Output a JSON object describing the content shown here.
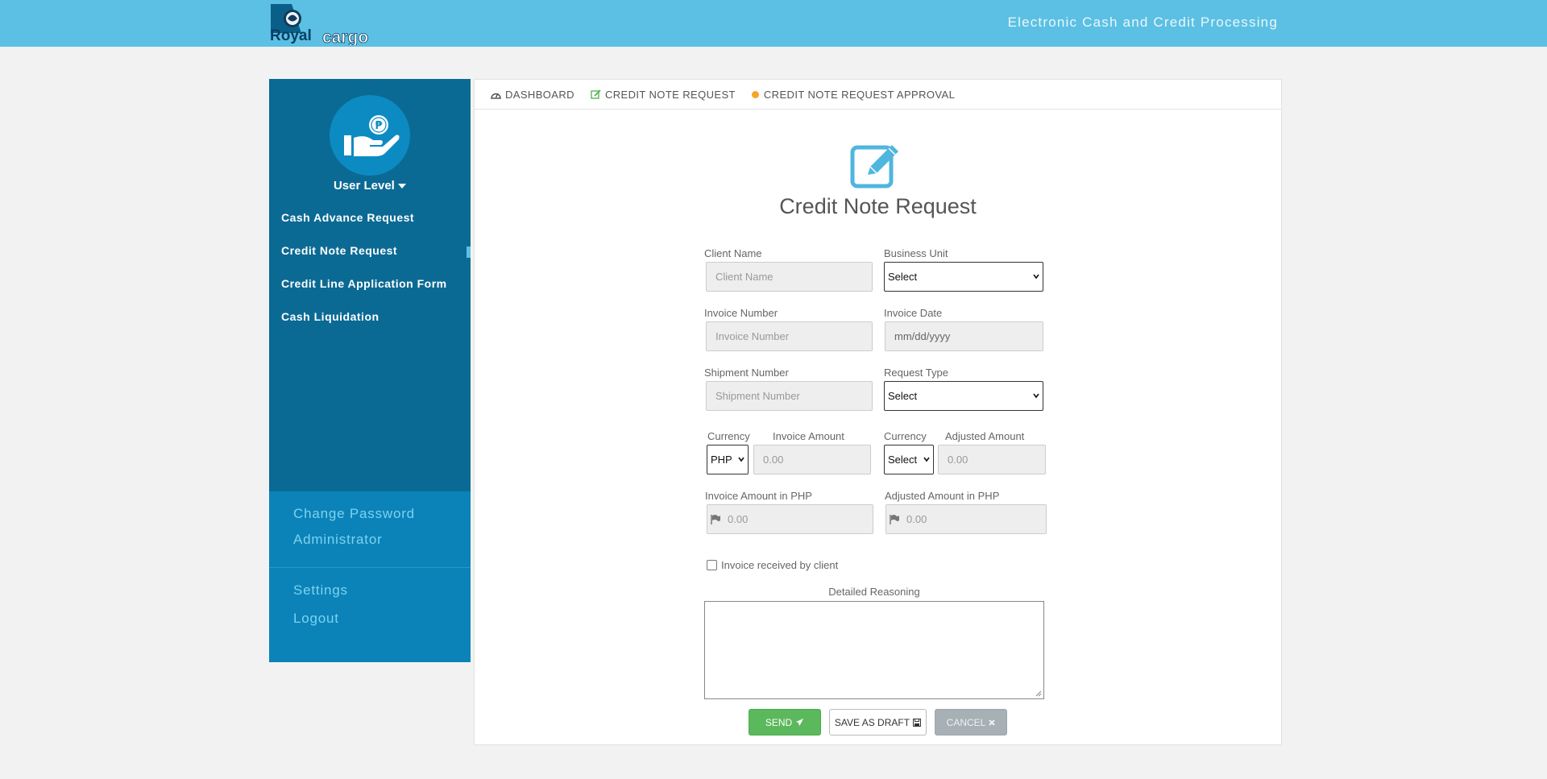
{
  "header": {
    "logo_text_1": "Royal",
    "logo_text_2": "cargo",
    "tagline": "Electronic Cash and Credit Processing"
  },
  "sidebar": {
    "user_level": "User Level",
    "items": [
      {
        "label": "Cash Advance Request"
      },
      {
        "label": "Credit Note Request",
        "active": true
      },
      {
        "label": "Credit Line Application Form"
      },
      {
        "label": "Cash Liquidation"
      }
    ],
    "change_password": "Change Password",
    "administrator": "Administrator",
    "settings": "Settings",
    "logout": "Logout"
  },
  "breadcrumb": {
    "dashboard": "DASHBOARD",
    "credit_note_request": "CREDIT NOTE REQUEST",
    "approval": "CREDIT NOTE REQUEST APPROVAL"
  },
  "form": {
    "title": "Credit Note Request",
    "client_name": {
      "label": "Client Name",
      "placeholder": "Client Name"
    },
    "business_unit": {
      "label": "Business Unit",
      "value": "Select"
    },
    "invoice_number": {
      "label": "Invoice Number",
      "placeholder": "Invoice Number"
    },
    "invoice_date": {
      "label": "Invoice Date",
      "placeholder": "mm/dd/yyyy"
    },
    "shipment_number": {
      "label": "Shipment Number",
      "placeholder": "Shipment Number"
    },
    "request_type": {
      "label": "Request Type",
      "value": "Select"
    },
    "currency_left": {
      "label": "Currency",
      "value": "PHP"
    },
    "invoice_amount": {
      "label": "Invoice Amount",
      "placeholder": "0.00"
    },
    "currency_right": {
      "label": "Currency",
      "value": "Select"
    },
    "adjusted_amount": {
      "label": "Adjusted Amount",
      "placeholder": "0.00"
    },
    "invoice_amount_php": {
      "label": "Invoice Amount in PHP",
      "placeholder": "0.00"
    },
    "adjusted_amount_php": {
      "label": "Adjusted Amount in PHP",
      "placeholder": "0.00"
    },
    "invoice_received": {
      "label": "Invoice received by client",
      "checked": false
    },
    "detailed_reasoning": {
      "label": "Detailed Reasoning"
    },
    "buttons": {
      "send": "SEND",
      "save_draft": "SAVE AS DRAFT",
      "cancel": "CANCEL"
    }
  },
  "colors": {
    "header_bg": "#5bc0e3",
    "sidebar_bg": "#0b6a94",
    "sidebar_bottom_bg": "#0b83b8",
    "accent": "#5bc0e3",
    "send_btn": "#5cb85c",
    "cancel_btn": "#a7b0b5",
    "approval_dot": "#f5a623"
  }
}
